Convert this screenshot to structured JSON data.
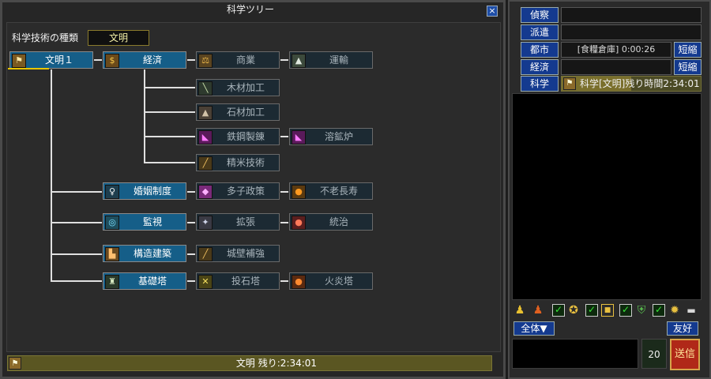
{
  "window": {
    "title": "科学ツリー",
    "close": "×"
  },
  "tree": {
    "kind_label": "科学技術の種類",
    "kind_value": "文明",
    "nodes": {
      "bunmei1": "文明１",
      "keizai": "経済",
      "shougyou": "商業",
      "unyu": "運輸",
      "mokuzai": "木材加工",
      "sekizai": "石材加工",
      "tekkou": "鉄鋼製錬",
      "youkouro": "溶鉱炉",
      "seimai": "精米技術",
      "konin": "婚姻制度",
      "tashi": "多子政策",
      "furou": "不老長寿",
      "kanshi": "監視",
      "kakuchou": "拡張",
      "touchi": "統治",
      "kouzou": "構造建築",
      "jouheki": "城壁補強",
      "kiso": "基礎塔",
      "touseki": "投石塔",
      "kaen": "火炎塔"
    }
  },
  "status": {
    "category": "文明",
    "remaining": "残り:2:34:01"
  },
  "side": {
    "rows": [
      {
        "button": "偵察",
        "field": ""
      },
      {
        "button": "派遣",
        "field": ""
      },
      {
        "button": "都市",
        "field": "[食糧倉庫] 0:00:26",
        "shorten": "短縮"
      },
      {
        "button": "経済",
        "field": "",
        "shorten": "短縮"
      },
      {
        "button": "科学",
        "field": "科学[文明]残り時間2:34:01"
      }
    ],
    "research_progress": 0.5,
    "filters": {
      "all": "全体▼",
      "friend": "友好"
    },
    "chat": {
      "count": "20",
      "send": "送信"
    }
  },
  "colors": {
    "accent": "#155e88",
    "gold": "#e8c500",
    "button_blue": "#143a8f",
    "send_red": "#b02818"
  }
}
